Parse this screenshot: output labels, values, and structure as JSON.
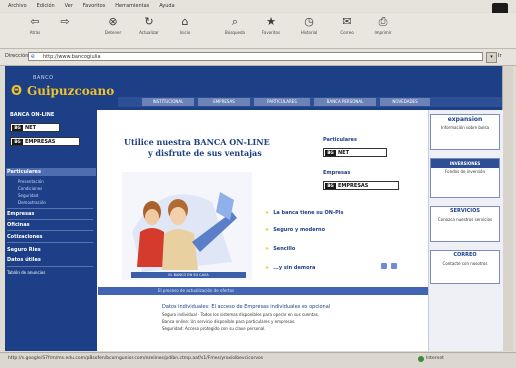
{
  "browser": {
    "menu": [
      "Archivo",
      "Edición",
      "Ver",
      "Favoritos",
      "Herramientas",
      "Ayuda"
    ],
    "toolbar": [
      {
        "icon": "back-arrow-icon",
        "label": "Atrás"
      },
      {
        "icon": "forward-arrow-icon",
        "label": ""
      },
      {
        "icon": "stop-icon",
        "label": "Detener"
      },
      {
        "icon": "refresh-icon",
        "label": "Actualizar"
      },
      {
        "icon": "home-icon",
        "label": "Inicio"
      },
      {
        "icon": "search-icon",
        "label": "Búsqueda"
      },
      {
        "icon": "favorites-icon",
        "label": "Favoritos"
      },
      {
        "icon": "history-icon",
        "label": "Historial"
      },
      {
        "icon": "mail-icon",
        "label": "Correo"
      },
      {
        "icon": "print-icon",
        "label": "Imprimir"
      }
    ],
    "address_label": "Dirección",
    "address": "http://www.bancogiulia",
    "go_label": "Ir",
    "status": "http://s.google/S7frm/ms.edu.com/pBsofen/bcorngunior.com/ezelines/pdibn.ctmp.aaf/s1/Fmes/yroxiolbevcicorvos",
    "zone": "Internet"
  },
  "site": {
    "bank_small": "BANCO",
    "bank_name": "Guipuzcoano",
    "nav": [
      "INSTITUCIONAL",
      "EMPRESAS",
      "PARTICULARES",
      "BANCA PERSONAL",
      "NOVEDADES"
    ],
    "sidebar": {
      "top": "BANCA ON-LINE",
      "net_label": "NET",
      "empresas_logo": "EMPRESAS",
      "particulares": "Particulares",
      "links": [
        "Presentación",
        "Condiciones",
        "Seguridad",
        "Demostración"
      ],
      "sections": [
        "Empresas",
        "Oficinas",
        "Cotizaciones",
        "Seguro Ries",
        "Datos útiles",
        "Tablón de anuncios"
      ]
    },
    "headline_1": "Utilice nuestra BANCA ON-LINE",
    "headline_2": "y disfrute de sus ventajas",
    "particulares_h": "Particulares",
    "empresas_h": "Empresas",
    "bullets": [
      "La banca tiene su ON-Pis",
      "Seguro y moderno",
      "Sencillo",
      "...y sin demora"
    ],
    "caption": "EL BANCO EN SU CASA",
    "blue_bar": "El proceso de actualización de ofertas",
    "info_title": "Datos individuales: El acceso de Empresas individuales es opcional",
    "info_lines": [
      "Seguro individual · Todos los sistemas disponibles para operar en sus cuentas.",
      "Banca online: Un servicio disponible para particulares y empresas.",
      "Seguridad: Acceso protegido con su clave personal."
    ],
    "right": [
      {
        "title": "expansion",
        "text": "Información sobre bolsa"
      },
      {
        "title": "INVERSIONES",
        "text": "Fondos de inversión"
      },
      {
        "title": "SERVICIOS",
        "text": "Conozca nuestros servicios"
      },
      {
        "title": "CORREO",
        "text": "Contacte con nosotros"
      }
    ]
  }
}
